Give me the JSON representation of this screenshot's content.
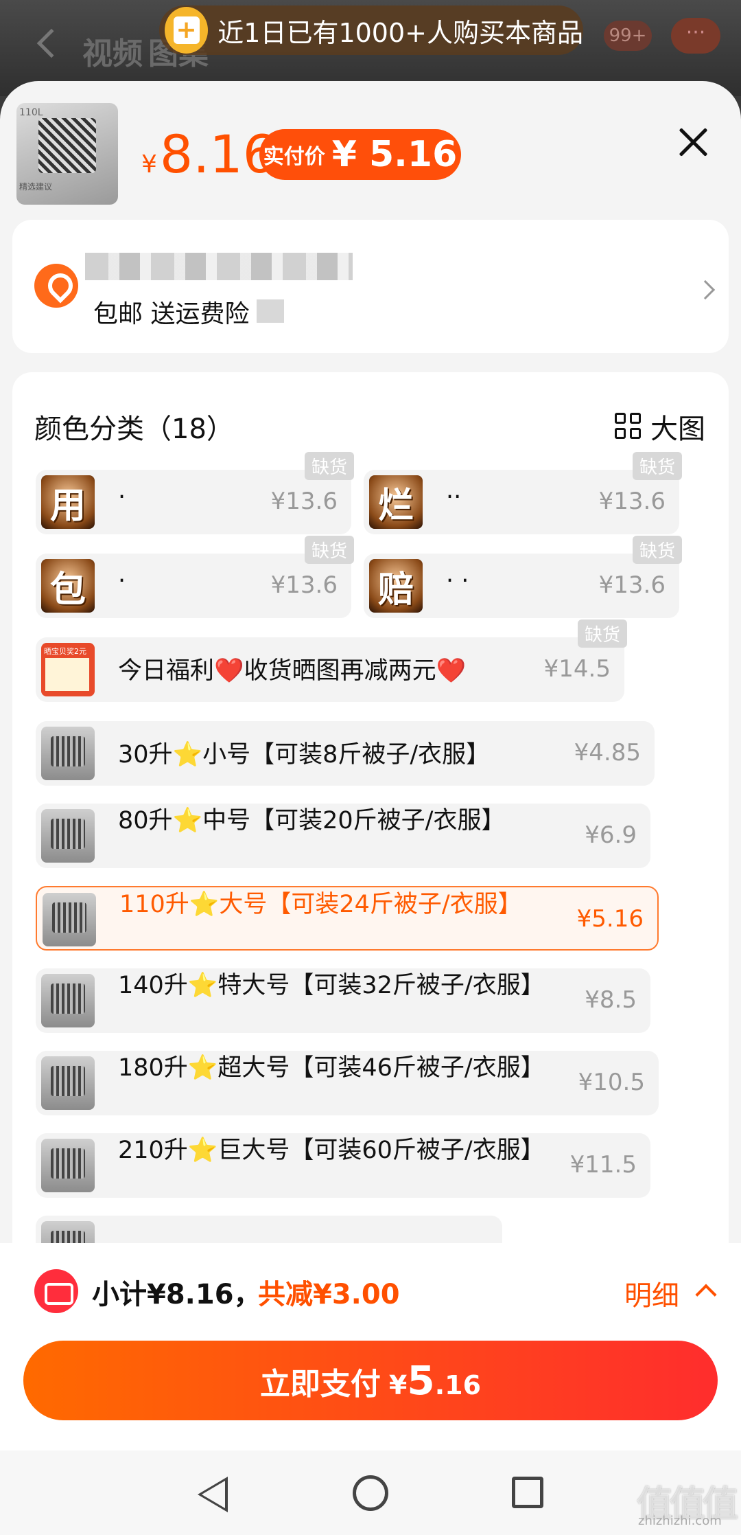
{
  "background": {
    "tab_video": "视频",
    "tab_images": "图集",
    "cart_badge": "99+",
    "more": "···"
  },
  "toast": {
    "text": "近1日已有1000+人购买本商品"
  },
  "header": {
    "thumb_tag": "110L",
    "thumb_note": "精选建议",
    "currency": "¥",
    "price": "8.16",
    "real_price_label": "实付价",
    "real_price_value": "¥ 5.16"
  },
  "address": {
    "shipping": "包邮 送运费险"
  },
  "sku": {
    "title": "颜色分类（18）",
    "big_image_label": "大图",
    "out_of_stock": "缺货",
    "char_options": [
      {
        "char": "用",
        "name": "·",
        "price": "¥13.6",
        "out": true
      },
      {
        "char": "烂",
        "name": "··",
        "price": "¥13.6",
        "out": true
      },
      {
        "char": "包",
        "name": "·",
        "price": "¥13.6",
        "out": true
      },
      {
        "char": "赔",
        "name": "· ·",
        "price": "¥13.6",
        "out": true
      }
    ],
    "welfare": {
      "img_text": "晒宝贝奖2元",
      "name": "今日福利❤️收货晒图再减两元❤️",
      "price": "¥14.5",
      "out": true
    },
    "options": [
      {
        "name": "30升⭐小号【可装8斤被子/衣服】",
        "price": "¥4.85",
        "selected": false
      },
      {
        "name": "80升⭐中号【可装20斤被子/衣服】",
        "price": "¥6.9",
        "selected": false
      },
      {
        "name": "110升⭐大号【可装24斤被子/衣服】",
        "price": "¥5.16",
        "selected": true
      },
      {
        "name": "140升⭐特大号【可装32斤被子/衣服】",
        "price": "¥8.5",
        "selected": false
      },
      {
        "name": "180升⭐超大号【可装46斤被子/衣服】",
        "price": "¥10.5",
        "selected": false
      },
      {
        "name": "210升⭐巨大号【可装60斤被子/衣服】",
        "price": "¥11.5",
        "selected": false
      }
    ]
  },
  "summary": {
    "subtotal": "小计¥8.16，",
    "discount": "共减¥3.00",
    "detail": "明细"
  },
  "pay": {
    "label": "立即支付",
    "currency": "¥",
    "int": "5",
    "dec": ".16"
  },
  "watermark": {
    "mark": "值值值",
    "url": "zhizhizhi.com"
  },
  "colors": {
    "accent": "#ff5000",
    "pay_gradient_start": "#ff6a00",
    "pay_gradient_end": "#ff2d2d"
  }
}
